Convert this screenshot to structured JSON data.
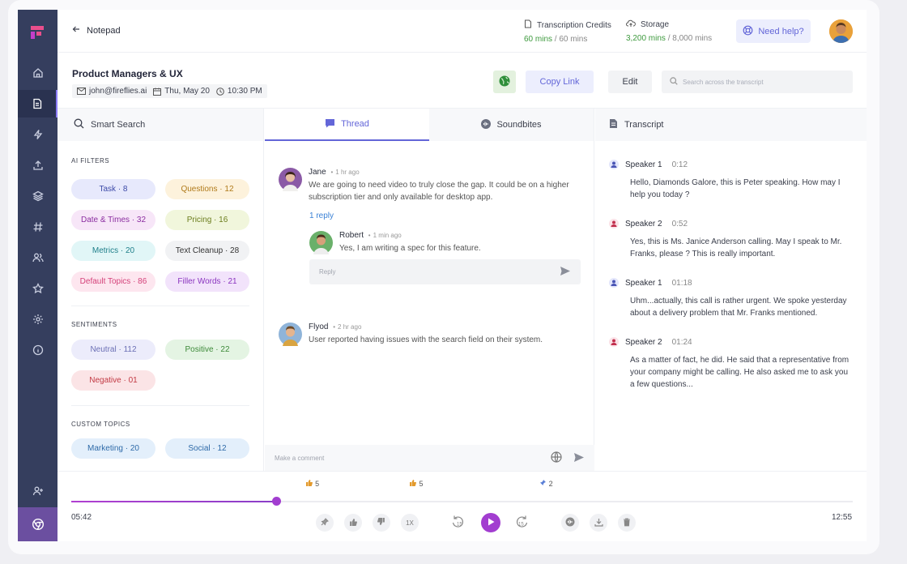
{
  "header": {
    "back_label": "Notepad",
    "credits_label": "Transcription Credits",
    "credits_used": "60 mins",
    "credits_total": "/ 60 mins",
    "storage_label": "Storage",
    "storage_used": "3,200 mins",
    "storage_total": "/ 8,000 mins",
    "help_label": "Need help?"
  },
  "meeting": {
    "title": "Product Managers & UX",
    "email": "john@fireflies.ai",
    "date": "Thu, May 20",
    "time": "10:30 PM",
    "copy_link": "Copy Link",
    "edit": "Edit",
    "search_placeholder": "Search across the transcript"
  },
  "left": {
    "title": "Smart Search",
    "ai_filters_label": "AI FILTERS",
    "ai_filters": [
      {
        "label": "Task · 8"
      },
      {
        "label": "Questions · 12"
      },
      {
        "label": "Date & Times · 32"
      },
      {
        "label": "Pricing · 16"
      },
      {
        "label": "Metrics · 20"
      },
      {
        "label": "Text Cleanup · 28"
      },
      {
        "label": "Default Topics · 86"
      },
      {
        "label": "Filler Words · 21"
      }
    ],
    "sentiments_label": "SENTIMENTS",
    "sentiments": [
      {
        "label": "Neutral · 112"
      },
      {
        "label": "Positive · 22"
      },
      {
        "label": "Negative · 01"
      }
    ],
    "custom_label": "CUSTOM TOPICS",
    "custom": [
      {
        "label": "Marketing · 20"
      },
      {
        "label": "Social · 12"
      }
    ]
  },
  "middle": {
    "tabs": [
      {
        "label": "Thread"
      },
      {
        "label": "Soundbites"
      }
    ],
    "messages": [
      {
        "name": "Jane",
        "time": "1 hr ago",
        "text": "We are going to need video to truly close the gap. It could be on a higher subscription tier and only available for desktop app.",
        "reply_count": "1 reply"
      },
      {
        "name": "Robert",
        "time": "1 min ago",
        "text": "Yes, I am writing a spec for this feature."
      },
      {
        "name": "Flyod",
        "time": "2 hr ago",
        "text": "User reported having issues with the search field on their system."
      }
    ],
    "reply_placeholder": "Reply",
    "comment_placeholder": "Make a comment"
  },
  "transcript": {
    "title": "Transcript",
    "entries": [
      {
        "speaker": "Speaker 1",
        "time": "0:12",
        "text": "Hello, Diamonds Galore, this is Peter speaking. How may I help you today ?"
      },
      {
        "speaker": "Speaker 2",
        "time": "0:52",
        "text": "Yes, this is Ms. Janice Anderson calling. May I speak to Mr. Franks, please ? This is really important."
      },
      {
        "speaker": "Speaker 1",
        "time": "01:18",
        "text": "Uhm...actually, this call is rather urgent. We spoke yesterday about a delivery problem that Mr. Franks mentioned."
      },
      {
        "speaker": "Speaker 2",
        "time": "01:24",
        "text": "As a matter of fact, he did. He said that a representative from your company might be calling. He also asked me to ask you a few questions..."
      }
    ]
  },
  "player": {
    "current": "05:42",
    "total": "12:55",
    "progress": 0.262,
    "markers": [
      {
        "count": "5",
        "at": 0.31
      },
      {
        "count": "5",
        "at": 0.443
      },
      {
        "count": "2",
        "at": 0.609
      }
    ],
    "speed": "1X",
    "skip": "15"
  },
  "colors": {
    "accent": "#6366d8",
    "play": "#a23dd0",
    "rail": "#353e5e"
  }
}
